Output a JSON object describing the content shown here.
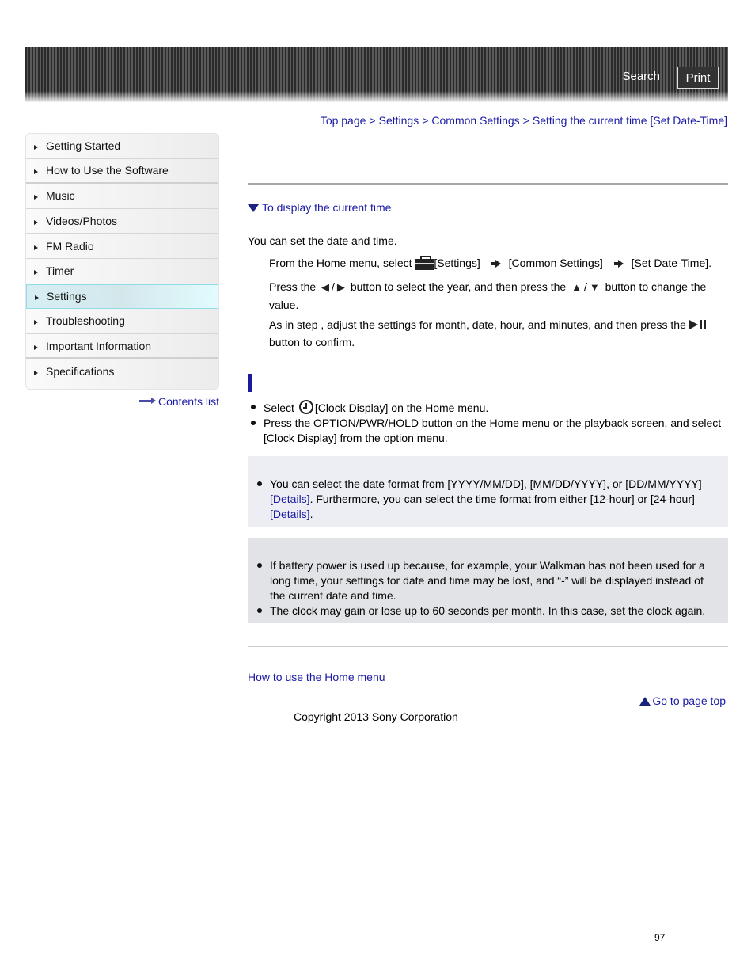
{
  "header": {
    "search_label": "Search",
    "print_label": "Print"
  },
  "breadcrumb": [
    {
      "label": "Top page"
    },
    {
      "label": "Settings"
    },
    {
      "label": "Common Settings"
    },
    {
      "label": "Setting the current time [Set Date-Time]"
    }
  ],
  "breadcrumb_separator": ">",
  "sidebar": {
    "items": [
      {
        "label": "Getting Started"
      },
      {
        "label": "How to Use the Software"
      },
      {
        "label": "Music"
      },
      {
        "label": "Videos/Photos"
      },
      {
        "label": "FM Radio"
      },
      {
        "label": "Timer"
      },
      {
        "label": "Settings",
        "active": true
      },
      {
        "label": "Troubleshooting"
      },
      {
        "label": "Important Information"
      },
      {
        "label": "Specifications"
      }
    ],
    "contents_link": "Contents list"
  },
  "main": {
    "anchor_link": "To display the current time",
    "intro": "You can set the date and time.",
    "step1": {
      "prefix": "From the Home menu, select",
      "item1": "[Settings]",
      "item2": "[Common Settings]",
      "item3": "[Set Date-Time]."
    },
    "step2": {
      "text_a": "Press the",
      "left_glyph": "◀",
      "slash": "/",
      "right_glyph": "▶",
      "text_b": "button to select the year, and then press the",
      "up_glyph": "▲",
      "down_glyph": "▼",
      "text_c": "button to change the value."
    },
    "step3": {
      "text_a": "As in step   , adjust the settings for month, date, hour, and minutes, and then press the",
      "text_b": "button to confirm."
    },
    "display_bullets": {
      "b1_prefix": "Select",
      "b1_suffix": "[Clock Display] on the Home menu.",
      "b2": "Press the OPTION/PWR/HOLD button on the Home menu or the playback screen, and select [Clock Display] from the option menu."
    },
    "hint": {
      "text_a": "You can select the date format from [YYYY/MM/DD], [MM/DD/YYYY], or [DD/MM/YYYY]",
      "link1": "[Details]",
      "text_b": ". Furthermore, you can select the time format from either [12-hour] or [24-hour]",
      "link2": "[Details]",
      "text_c": "."
    },
    "notes": [
      "If battery power is used up because, for example, your Walkman has not been used for a long time, your settings for date and time may be lost, and “-” will be displayed instead of the current date and time.",
      "The clock may gain or lose up to 60 seconds per month. In this case, set the clock again."
    ],
    "related_link": "How to use the Home menu",
    "page_top_link": "Go to page top"
  },
  "footer": {
    "copyright": "Copyright 2013 Sony Corporation",
    "page_number": "97"
  },
  "colors": {
    "link": "#1a1aa6",
    "active_nav": "#d6eef2",
    "hint_bg": "#eceef3",
    "note_bg": "#e1e3e7",
    "section_bar": "#1a1a9a"
  }
}
